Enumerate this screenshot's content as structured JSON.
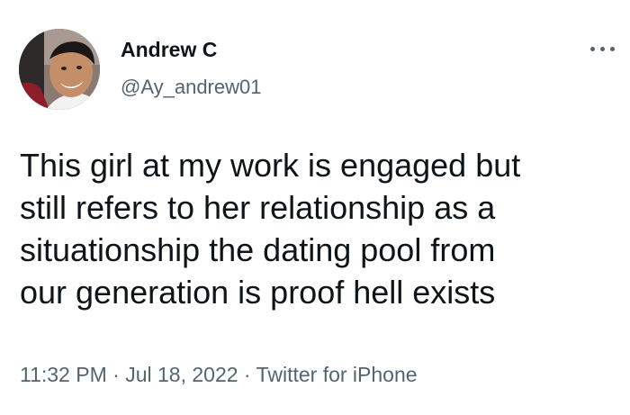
{
  "author": {
    "display_name": "Andrew C",
    "handle": "@Ay_andrew01"
  },
  "icons": {
    "more": "more-horizontal-icon"
  },
  "tweet": {
    "text": "This girl at my work is engaged but\nstill refers to her relationship as a\nsituationship the dating pool from\nour generation is proof hell exists"
  },
  "meta": {
    "time": "11:32 PM",
    "separator": "·",
    "date": "Jul 18, 2022",
    "source": "Twitter for iPhone"
  },
  "colors": {
    "text_primary": "#0f1419",
    "text_secondary": "#536471",
    "background": "#ffffff"
  }
}
